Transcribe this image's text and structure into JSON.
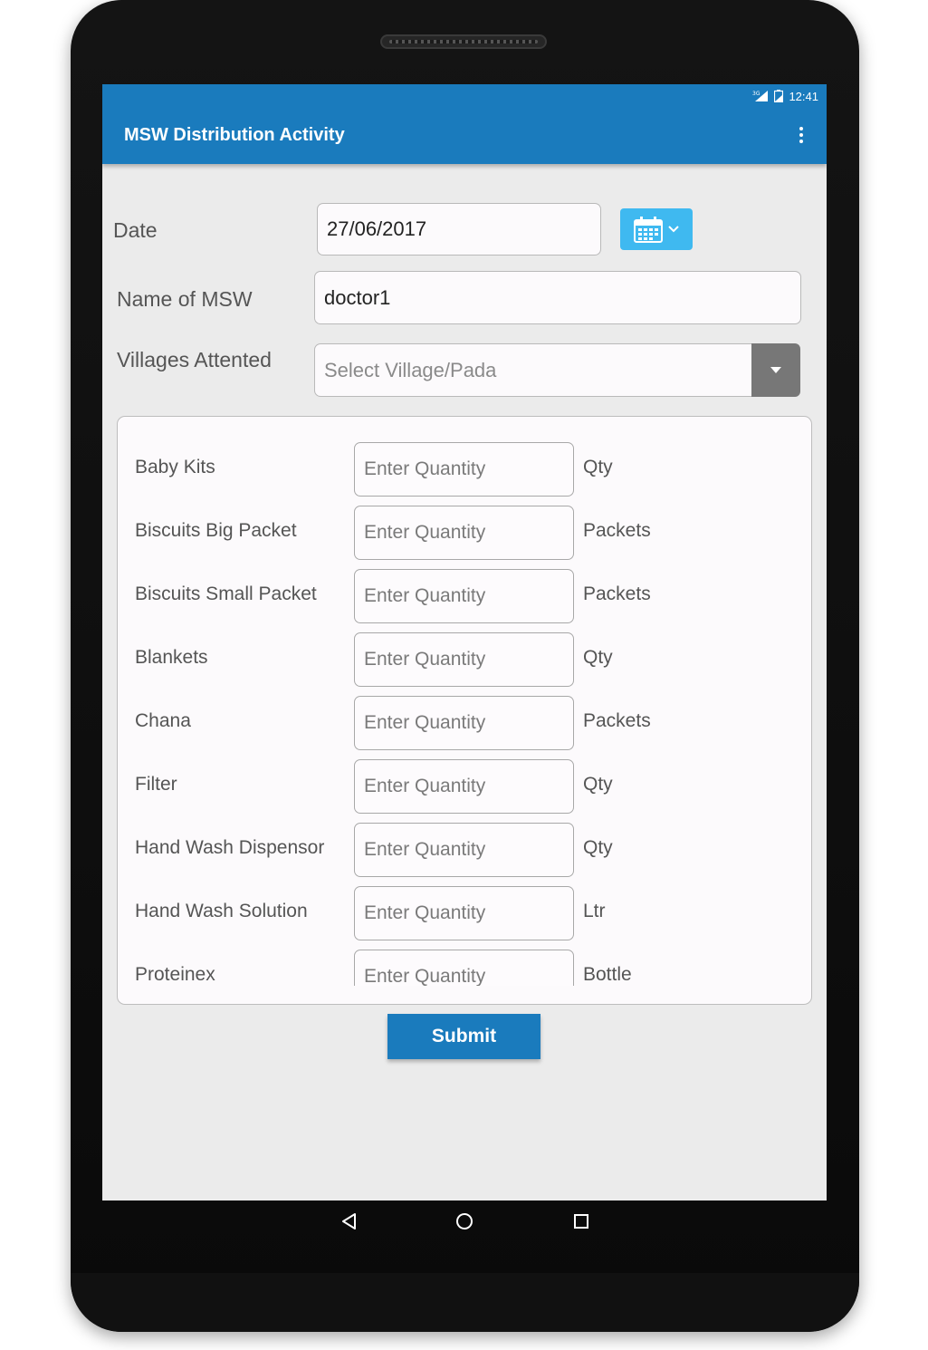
{
  "status_bar": {
    "network": "3G",
    "time": "12:41"
  },
  "app_bar": {
    "title": "MSW Distribution Activity"
  },
  "form": {
    "date_label": "Date",
    "date_value": "27/06/2017",
    "msw_label": "Name of MSW",
    "msw_value": "doctor1",
    "villages_label": "Villages Attented",
    "villages_placeholder": "Select Village/Pada"
  },
  "items": [
    {
      "name": "Baby Kits",
      "placeholder": "Enter Quantity",
      "unit": "Qty"
    },
    {
      "name": "Biscuits Big Packet",
      "placeholder": "Enter Quantity",
      "unit": "Packets"
    },
    {
      "name": "Biscuits Small Packet",
      "placeholder": "Enter Quantity",
      "unit": "Packets"
    },
    {
      "name": "Blankets",
      "placeholder": "Enter Quantity",
      "unit": "Qty"
    },
    {
      "name": "Chana",
      "placeholder": "Enter Quantity",
      "unit": "Packets"
    },
    {
      "name": "Filter",
      "placeholder": "Enter Quantity",
      "unit": "Qty"
    },
    {
      "name": "Hand Wash Dispensor",
      "placeholder": "Enter Quantity",
      "unit": "Qty"
    },
    {
      "name": "Hand Wash Solution",
      "placeholder": "Enter Quantity",
      "unit": "Ltr"
    },
    {
      "name": "Proteinex",
      "placeholder": "Enter Quantity",
      "unit": "Bottle"
    }
  ],
  "submit_label": "Submit",
  "colors": {
    "primary": "#1a7bbd",
    "calendar_button": "#3fb9f0",
    "dropdown_button": "#777777"
  },
  "icons": {
    "calendar": "calendar-icon",
    "menu": "overflow-menu-icon",
    "back": "back-icon",
    "home": "home-icon",
    "recents": "recents-icon"
  }
}
